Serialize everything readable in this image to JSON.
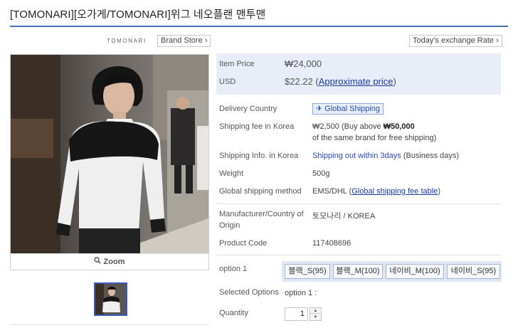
{
  "product": {
    "title": "[TOMONARI][오가게/TOMONARI]위그 네오플랜 맨투맨"
  },
  "brand": {
    "logo_text": "TOMONARI",
    "store_label": "Brand Store ›"
  },
  "exchange_label": "Today's exchange Rate ›",
  "gallery": {
    "zoom_label": "Zoom",
    "zoom_icon": "magnifier-icon",
    "thumbnail_count": 1
  },
  "price": {
    "item_price_label": "Item Price",
    "item_price_value": "₩24,000",
    "usd_label": "USD",
    "usd_value": "$22.22",
    "approx_open": "(",
    "approx_link": "Approximate price",
    "approx_close": ")"
  },
  "delivery": {
    "country_label": "Delivery Country",
    "country_badge": "Global Shipping",
    "country_icon": "airplane-icon",
    "fee_label": "Shipping fee in Korea",
    "fee_value": "₩2,500 (Buy above",
    "fee_threshold": "₩50,000",
    "fee_note": "of the same brand for free shipping)",
    "info_label": "Shipping Info. in Korea",
    "info_link": "Shipping out within 3days",
    "info_suffix": "(Business days)",
    "weight_label": "Weight",
    "weight_value": "500g",
    "method_label": "Global shipping method",
    "method_value": "EMS/DHL (",
    "method_link": "Global shipping fee table",
    "method_close": ")"
  },
  "specs": {
    "maker_label_line1": "Manufacturer/Country of",
    "maker_label_line2": "Origin",
    "maker_value": "토모나리 / KOREA",
    "code_label": "Product Code",
    "code_value": "117408696"
  },
  "options": {
    "label": "option 1",
    "items": [
      "블랙_S(95)",
      "블랙_M(100)",
      "네이비_M(100)",
      "네이비_S(95)"
    ],
    "selected_label": "Selected Options",
    "selected_value": "option 1 :"
  },
  "quantity": {
    "label": "Quantity",
    "value": "1"
  },
  "colors": {
    "accent": "#4a6fc0",
    "price_bg": "#e8edf7",
    "link": "#1a3a9a"
  }
}
